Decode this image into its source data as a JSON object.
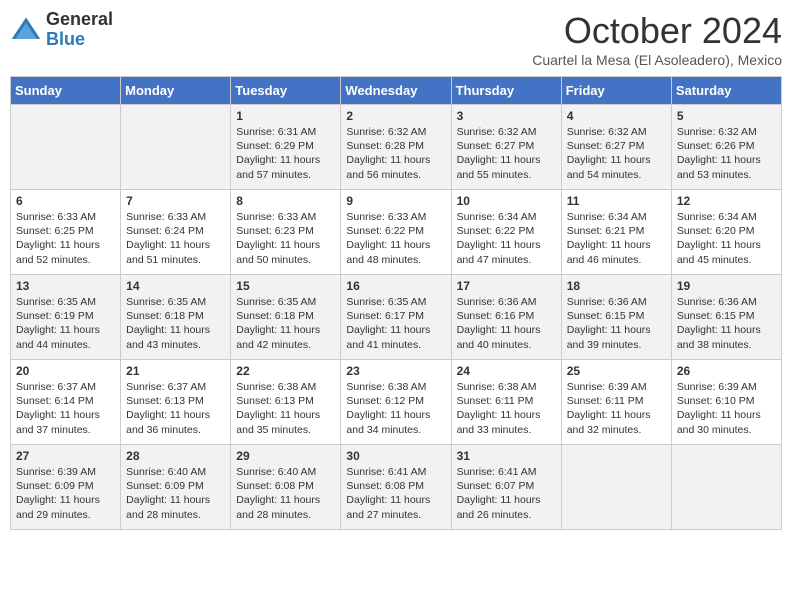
{
  "header": {
    "logo": {
      "general": "General",
      "blue": "Blue"
    },
    "title": "October 2024",
    "subtitle": "Cuartel la Mesa (El Asoleadero), Mexico"
  },
  "days_of_week": [
    "Sunday",
    "Monday",
    "Tuesday",
    "Wednesday",
    "Thursday",
    "Friday",
    "Saturday"
  ],
  "weeks": [
    [
      {
        "day": "",
        "sunrise": "",
        "sunset": "",
        "daylight": ""
      },
      {
        "day": "",
        "sunrise": "",
        "sunset": "",
        "daylight": ""
      },
      {
        "day": "1",
        "sunrise": "Sunrise: 6:31 AM",
        "sunset": "Sunset: 6:29 PM",
        "daylight": "Daylight: 11 hours and 57 minutes."
      },
      {
        "day": "2",
        "sunrise": "Sunrise: 6:32 AM",
        "sunset": "Sunset: 6:28 PM",
        "daylight": "Daylight: 11 hours and 56 minutes."
      },
      {
        "day": "3",
        "sunrise": "Sunrise: 6:32 AM",
        "sunset": "Sunset: 6:27 PM",
        "daylight": "Daylight: 11 hours and 55 minutes."
      },
      {
        "day": "4",
        "sunrise": "Sunrise: 6:32 AM",
        "sunset": "Sunset: 6:27 PM",
        "daylight": "Daylight: 11 hours and 54 minutes."
      },
      {
        "day": "5",
        "sunrise": "Sunrise: 6:32 AM",
        "sunset": "Sunset: 6:26 PM",
        "daylight": "Daylight: 11 hours and 53 minutes."
      }
    ],
    [
      {
        "day": "6",
        "sunrise": "Sunrise: 6:33 AM",
        "sunset": "Sunset: 6:25 PM",
        "daylight": "Daylight: 11 hours and 52 minutes."
      },
      {
        "day": "7",
        "sunrise": "Sunrise: 6:33 AM",
        "sunset": "Sunset: 6:24 PM",
        "daylight": "Daylight: 11 hours and 51 minutes."
      },
      {
        "day": "8",
        "sunrise": "Sunrise: 6:33 AM",
        "sunset": "Sunset: 6:23 PM",
        "daylight": "Daylight: 11 hours and 50 minutes."
      },
      {
        "day": "9",
        "sunrise": "Sunrise: 6:33 AM",
        "sunset": "Sunset: 6:22 PM",
        "daylight": "Daylight: 11 hours and 48 minutes."
      },
      {
        "day": "10",
        "sunrise": "Sunrise: 6:34 AM",
        "sunset": "Sunset: 6:22 PM",
        "daylight": "Daylight: 11 hours and 47 minutes."
      },
      {
        "day": "11",
        "sunrise": "Sunrise: 6:34 AM",
        "sunset": "Sunset: 6:21 PM",
        "daylight": "Daylight: 11 hours and 46 minutes."
      },
      {
        "day": "12",
        "sunrise": "Sunrise: 6:34 AM",
        "sunset": "Sunset: 6:20 PM",
        "daylight": "Daylight: 11 hours and 45 minutes."
      }
    ],
    [
      {
        "day": "13",
        "sunrise": "Sunrise: 6:35 AM",
        "sunset": "Sunset: 6:19 PM",
        "daylight": "Daylight: 11 hours and 44 minutes."
      },
      {
        "day": "14",
        "sunrise": "Sunrise: 6:35 AM",
        "sunset": "Sunset: 6:18 PM",
        "daylight": "Daylight: 11 hours and 43 minutes."
      },
      {
        "day": "15",
        "sunrise": "Sunrise: 6:35 AM",
        "sunset": "Sunset: 6:18 PM",
        "daylight": "Daylight: 11 hours and 42 minutes."
      },
      {
        "day": "16",
        "sunrise": "Sunrise: 6:35 AM",
        "sunset": "Sunset: 6:17 PM",
        "daylight": "Daylight: 11 hours and 41 minutes."
      },
      {
        "day": "17",
        "sunrise": "Sunrise: 6:36 AM",
        "sunset": "Sunset: 6:16 PM",
        "daylight": "Daylight: 11 hours and 40 minutes."
      },
      {
        "day": "18",
        "sunrise": "Sunrise: 6:36 AM",
        "sunset": "Sunset: 6:15 PM",
        "daylight": "Daylight: 11 hours and 39 minutes."
      },
      {
        "day": "19",
        "sunrise": "Sunrise: 6:36 AM",
        "sunset": "Sunset: 6:15 PM",
        "daylight": "Daylight: 11 hours and 38 minutes."
      }
    ],
    [
      {
        "day": "20",
        "sunrise": "Sunrise: 6:37 AM",
        "sunset": "Sunset: 6:14 PM",
        "daylight": "Daylight: 11 hours and 37 minutes."
      },
      {
        "day": "21",
        "sunrise": "Sunrise: 6:37 AM",
        "sunset": "Sunset: 6:13 PM",
        "daylight": "Daylight: 11 hours and 36 minutes."
      },
      {
        "day": "22",
        "sunrise": "Sunrise: 6:38 AM",
        "sunset": "Sunset: 6:13 PM",
        "daylight": "Daylight: 11 hours and 35 minutes."
      },
      {
        "day": "23",
        "sunrise": "Sunrise: 6:38 AM",
        "sunset": "Sunset: 6:12 PM",
        "daylight": "Daylight: 11 hours and 34 minutes."
      },
      {
        "day": "24",
        "sunrise": "Sunrise: 6:38 AM",
        "sunset": "Sunset: 6:11 PM",
        "daylight": "Daylight: 11 hours and 33 minutes."
      },
      {
        "day": "25",
        "sunrise": "Sunrise: 6:39 AM",
        "sunset": "Sunset: 6:11 PM",
        "daylight": "Daylight: 11 hours and 32 minutes."
      },
      {
        "day": "26",
        "sunrise": "Sunrise: 6:39 AM",
        "sunset": "Sunset: 6:10 PM",
        "daylight": "Daylight: 11 hours and 30 minutes."
      }
    ],
    [
      {
        "day": "27",
        "sunrise": "Sunrise: 6:39 AM",
        "sunset": "Sunset: 6:09 PM",
        "daylight": "Daylight: 11 hours and 29 minutes."
      },
      {
        "day": "28",
        "sunrise": "Sunrise: 6:40 AM",
        "sunset": "Sunset: 6:09 PM",
        "daylight": "Daylight: 11 hours and 28 minutes."
      },
      {
        "day": "29",
        "sunrise": "Sunrise: 6:40 AM",
        "sunset": "Sunset: 6:08 PM",
        "daylight": "Daylight: 11 hours and 28 minutes."
      },
      {
        "day": "30",
        "sunrise": "Sunrise: 6:41 AM",
        "sunset": "Sunset: 6:08 PM",
        "daylight": "Daylight: 11 hours and 27 minutes."
      },
      {
        "day": "31",
        "sunrise": "Sunrise: 6:41 AM",
        "sunset": "Sunset: 6:07 PM",
        "daylight": "Daylight: 11 hours and 26 minutes."
      },
      {
        "day": "",
        "sunrise": "",
        "sunset": "",
        "daylight": ""
      },
      {
        "day": "",
        "sunrise": "",
        "sunset": "",
        "daylight": ""
      }
    ]
  ]
}
